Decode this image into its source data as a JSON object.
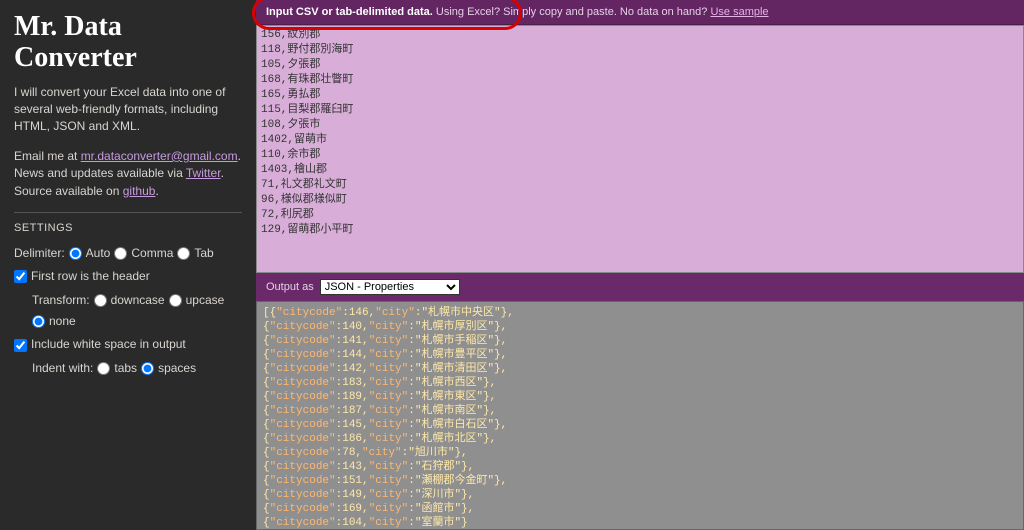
{
  "sidebar": {
    "title": "Mr. Data Converter",
    "intro": "I will convert your Excel data into one of several web-friendly formats, including HTML, JSON and XML.",
    "email_pre": "Email me at ",
    "email": "mr.dataconverter@gmail.com",
    "email_post": ". News and updates available via ",
    "twitter": "Twitter",
    "source_pre": ". Source available on ",
    "github": "github",
    "tail": "."
  },
  "settings": {
    "header": "SETTINGS",
    "delimiter_label": "Delimiter:",
    "delim": {
      "auto": "Auto",
      "comma": "Comma",
      "tab": "Tab"
    },
    "first_row": "First row is the header",
    "transform_label": "Transform:",
    "transform": {
      "down": "downcase",
      "up": "upcase",
      "none": "none"
    },
    "whitespace": "Include white space in output",
    "indent_label": "Indent with:",
    "indent": {
      "tabs": "tabs",
      "spaces": "spaces"
    }
  },
  "input": {
    "bar_bold": "Input CSV or tab-delimited data.",
    "bar_rest": " Using Excel? Simply copy and paste. No data on hand? ",
    "bar_link": "Use sample",
    "lines": [
      "156,紋別郡",
      "118,野付郡別海町",
      "105,夕張郡",
      "168,有珠郡壮瞥町",
      "165,勇払郡",
      "115,目梨郡羅臼町",
      "108,夕張市",
      "1402,留萌市",
      "110,余市郡",
      "1403,檜山郡",
      "71,礼文郡礼文町",
      "96,様似郡様似町",
      "72,利尻郡",
      "129,留萌郡小平町"
    ]
  },
  "output": {
    "label": "Output as",
    "selected": "JSON - Properties",
    "lines": [
      {
        "code": 146,
        "city": "札幌市中央区"
      },
      {
        "code": 140,
        "city": "札幌市厚別区"
      },
      {
        "code": 141,
        "city": "札幌市手稲区"
      },
      {
        "code": 144,
        "city": "札幌市豊平区"
      },
      {
        "code": 142,
        "city": "札幌市清田区"
      },
      {
        "code": 183,
        "city": "札幌市西区"
      },
      {
        "code": 189,
        "city": "札幌市東区"
      },
      {
        "code": 187,
        "city": "札幌市南区"
      },
      {
        "code": 145,
        "city": "札幌市白石区"
      },
      {
        "code": 186,
        "city": "札幌市北区"
      },
      {
        "code": 78,
        "city": "旭川市"
      },
      {
        "code": 143,
        "city": "石狩郡"
      },
      {
        "code": 151,
        "city": "瀬棚郡今金町"
      },
      {
        "code": 149,
        "city": "深川市"
      },
      {
        "code": 169,
        "city": "函館市"
      },
      {
        "code": 104,
        "city": "室蘭市"
      }
    ]
  }
}
